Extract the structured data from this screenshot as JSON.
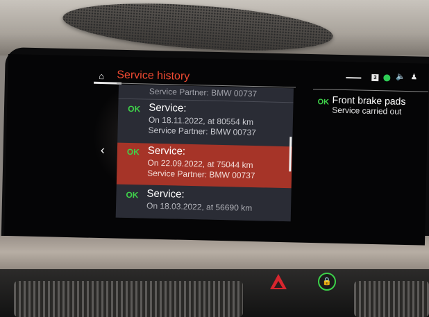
{
  "header": {
    "title": "Service history",
    "home_icon": "home-icon",
    "status_badge": "3"
  },
  "list": {
    "partial_top": "Service Partner: BMW 00737",
    "items": [
      {
        "status": "OK",
        "label": "Service:",
        "date": "On 18.11.2022, at 80554 km",
        "partner": "Service Partner: BMW 00737"
      },
      {
        "status": "OK",
        "label": "Service:",
        "date": "On 22.09.2022, at 75044 km",
        "partner": "Service Partner: BMW 00737",
        "selected": true
      },
      {
        "status": "OK",
        "label": "Service:",
        "date": "On 18.03.2022, at 56690 km",
        "partner": ""
      }
    ]
  },
  "detail": {
    "status": "OK",
    "title": "Front brake pads",
    "subtitle": "Service carried out"
  },
  "colors": {
    "accent": "#ef4a32",
    "ok_green": "#3fd24a",
    "selected_row": "#a63428",
    "list_bg": "#2a2c35"
  }
}
